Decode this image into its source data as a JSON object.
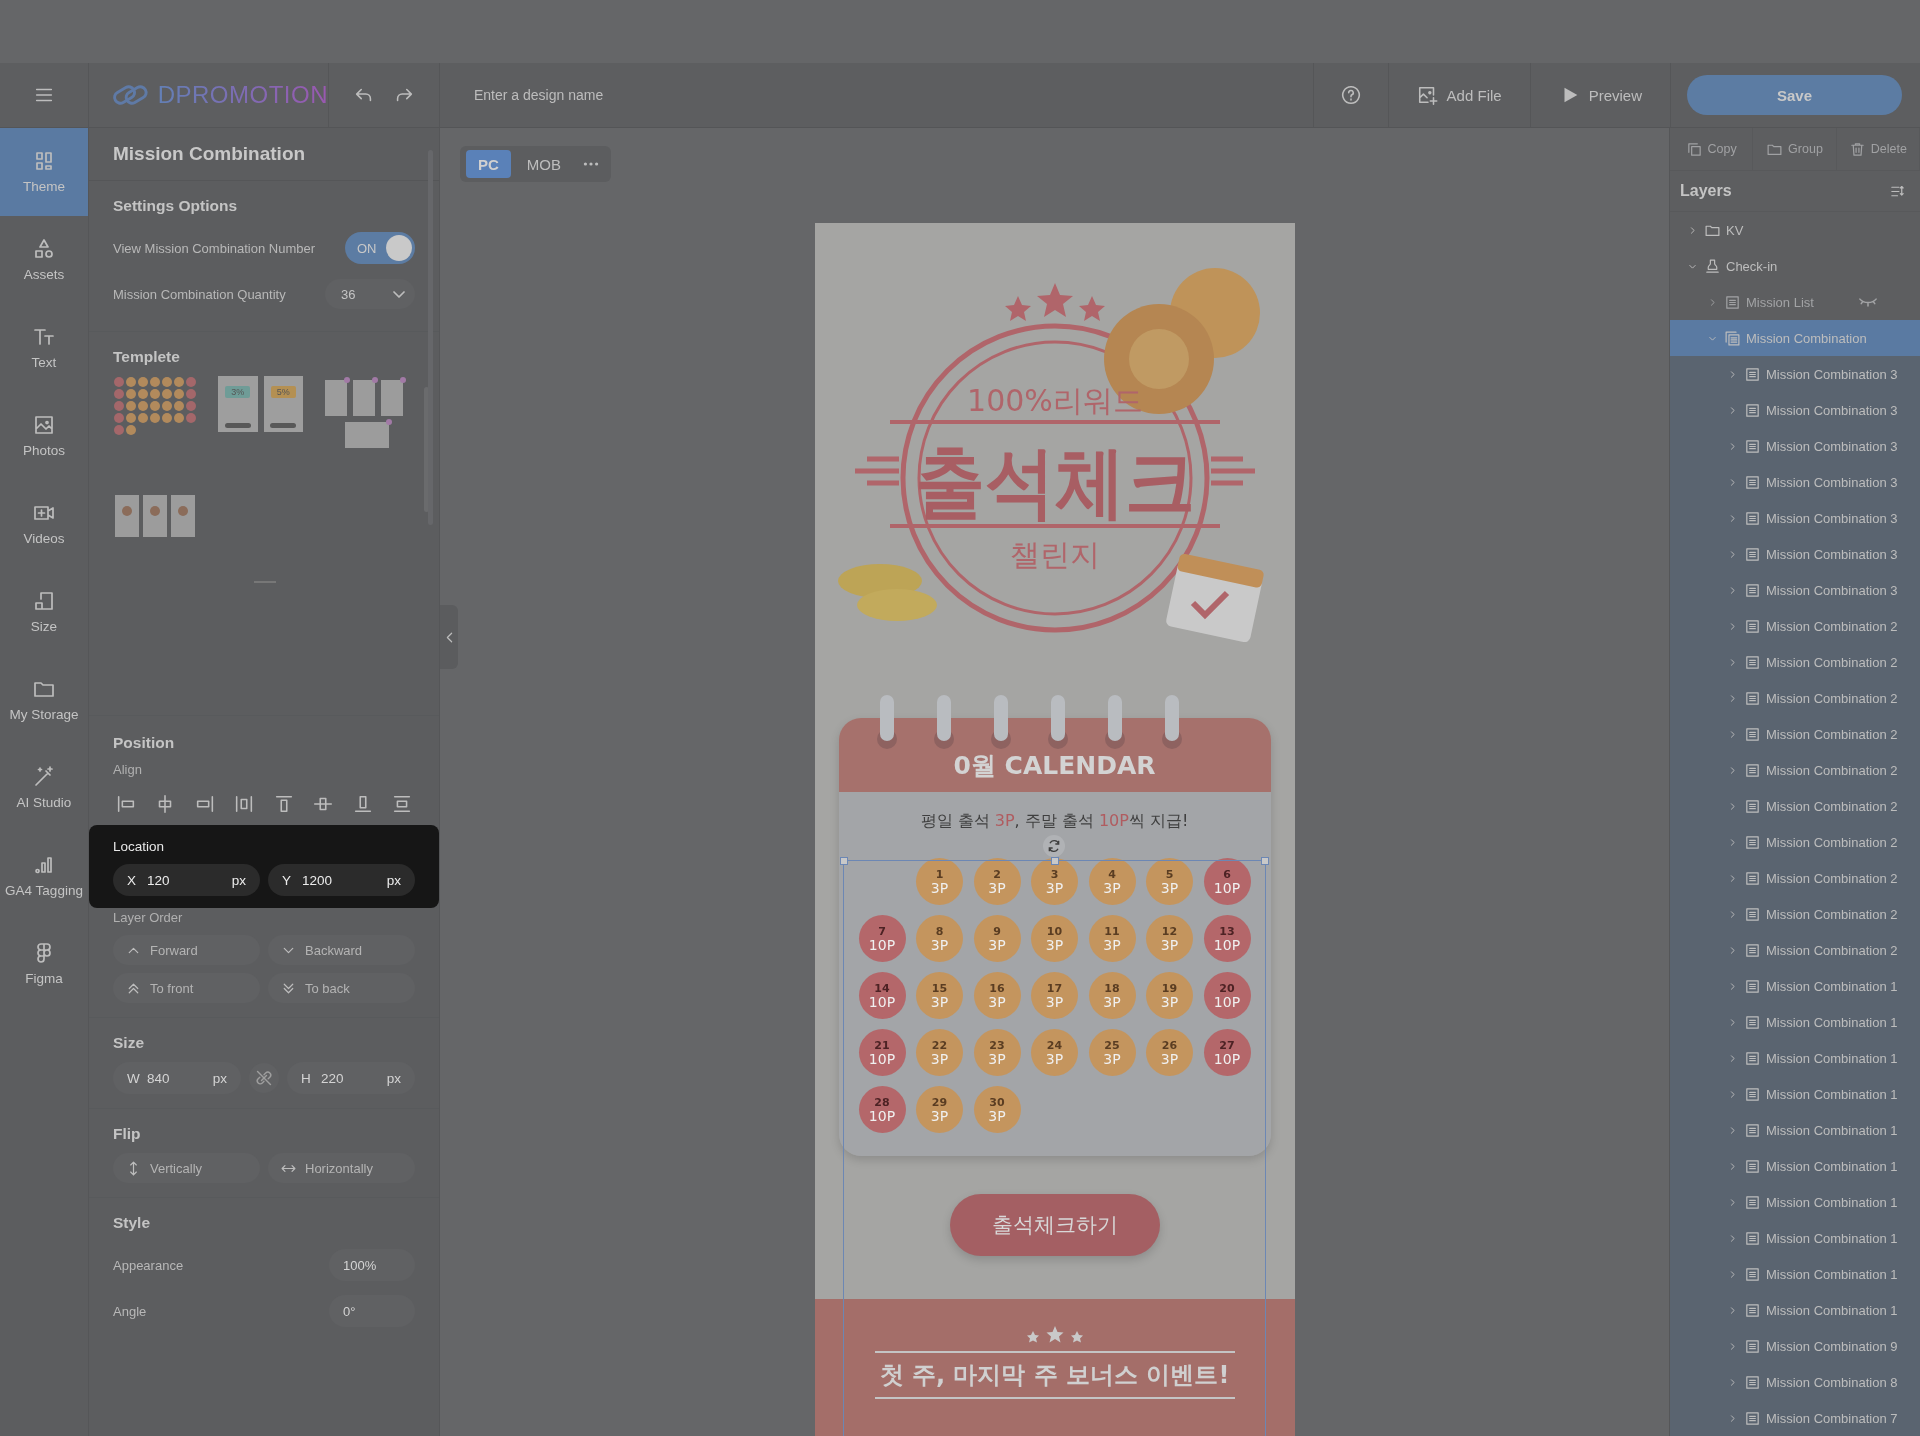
{
  "top_bar": {
    "logo": "DPROMOTION",
    "design_name": {
      "placeholder": "Enter a design name"
    },
    "actions": [
      {
        "label": "Add File",
        "kind": "addimage"
      },
      {
        "label": "Preview",
        "kind": "play"
      }
    ],
    "save": "Save"
  },
  "rail": [
    {
      "label": "Theme",
      "kind": "grid",
      "selected": true
    },
    {
      "label": "Assets",
      "kind": "shapes",
      "selected": false
    },
    {
      "label": "Text",
      "kind": "type",
      "selected": false
    },
    {
      "label": "Photos",
      "kind": "image",
      "selected": false
    },
    {
      "label": "Videos",
      "kind": "video",
      "selected": false
    },
    {
      "label": "Size",
      "kind": "resize",
      "selected": false
    },
    {
      "label": "My Storage",
      "kind": "folder",
      "selected": false
    },
    {
      "label": "AI Studio",
      "kind": "wand",
      "selected": false
    },
    {
      "label": "GA4 Tagging",
      "kind": "bars",
      "selected": false
    },
    {
      "label": "Figma",
      "kind": "figma",
      "selected": false
    }
  ],
  "panel": {
    "title": "Mission Combination",
    "settings": {
      "heading": "Settings Options",
      "number_toggle": {
        "label": "View Mission Combination Number",
        "on": true,
        "text": "ON"
      },
      "quantity": {
        "label": "Mission Combination Quantity",
        "value": "36"
      }
    },
    "template": {
      "heading": "Templete",
      "items": [
        {
          "kind": "dots"
        },
        {
          "kind": "coupons",
          "labels": [
            "3%",
            "5%"
          ]
        },
        {
          "kind": "cards"
        },
        {
          "kind": "products"
        }
      ]
    },
    "position": {
      "heading": "Position",
      "align_label": "Align",
      "location": {
        "label": "Location",
        "fields": [
          {
            "axis": "X",
            "value": "120",
            "unit": "px"
          },
          {
            "axis": "Y",
            "value": "1200",
            "unit": "px"
          }
        ]
      },
      "order_label": "Layer Order",
      "order_buttons": [
        {
          "label": "Forward",
          "kind": "up"
        },
        {
          "label": "Backward",
          "kind": "down"
        },
        {
          "label": "To front",
          "kind": "top"
        },
        {
          "label": "To back",
          "kind": "bottom"
        }
      ]
    },
    "size": {
      "heading": "Size",
      "fields": [
        {
          "axis": "W",
          "value": "840",
          "unit": "px"
        },
        {
          "axis": "H",
          "value": "220",
          "unit": "px"
        }
      ]
    },
    "flip": {
      "heading": "Flip",
      "buttons": [
        {
          "label": "Vertically",
          "kind": "vertical"
        },
        {
          "label": "Horizontally",
          "kind": "horizontal"
        }
      ]
    },
    "style": {
      "heading": "Style",
      "rows": [
        {
          "label": "Appearance",
          "value": "100%"
        },
        {
          "label": "Angle",
          "value": "0°"
        }
      ]
    }
  },
  "canvas": {
    "views": [
      {
        "label": "PC",
        "selected": true
      },
      {
        "label": "MOB",
        "selected": false
      }
    ],
    "design": {
      "hero": {
        "top_text": "100%리워드",
        "title": "출석체크",
        "subtitle": "챌린지"
      },
      "calendar": {
        "title": "0월 CALENDAR",
        "subtitle": [
          {
            "text": "평일 출석 ",
            "highlight": false
          },
          {
            "text": "3P",
            "highlight": true
          },
          {
            "text": ", 주말 출석 ",
            "highlight": false
          },
          {
            "text": "10P",
            "highlight": true
          },
          {
            "text": "씩 지급!",
            "highlight": false
          }
        ],
        "cells": [
          {
            "kind": "blank"
          },
          {
            "kind": "weekday",
            "day": "1",
            "points": "3P"
          },
          {
            "kind": "weekday",
            "day": "2",
            "points": "3P"
          },
          {
            "kind": "weekday",
            "day": "3",
            "points": "3P"
          },
          {
            "kind": "weekday",
            "day": "4",
            "points": "3P"
          },
          {
            "kind": "weekday",
            "day": "5",
            "points": "3P"
          },
          {
            "kind": "weekend",
            "day": "6",
            "points": "10P"
          },
          {
            "kind": "weekend",
            "day": "7",
            "points": "10P"
          },
          {
            "kind": "weekday",
            "day": "8",
            "points": "3P"
          },
          {
            "kind": "weekday",
            "day": "9",
            "points": "3P"
          },
          {
            "kind": "weekday",
            "day": "10",
            "points": "3P"
          },
          {
            "kind": "weekday",
            "day": "11",
            "points": "3P"
          },
          {
            "kind": "weekday",
            "day": "12",
            "points": "3P"
          },
          {
            "kind": "weekend",
            "day": "13",
            "points": "10P"
          },
          {
            "kind": "weekend",
            "day": "14",
            "points": "10P"
          },
          {
            "kind": "weekday",
            "day": "15",
            "points": "3P"
          },
          {
            "kind": "weekday",
            "day": "16",
            "points": "3P"
          },
          {
            "kind": "weekday",
            "day": "17",
            "points": "3P"
          },
          {
            "kind": "weekday",
            "day": "18",
            "points": "3P"
          },
          {
            "kind": "weekday",
            "day": "19",
            "points": "3P"
          },
          {
            "kind": "weekend",
            "day": "20",
            "points": "10P"
          },
          {
            "kind": "weekend",
            "day": "21",
            "points": "10P"
          },
          {
            "kind": "weekday",
            "day": "22",
            "points": "3P"
          },
          {
            "kind": "weekday",
            "day": "23",
            "points": "3P"
          },
          {
            "kind": "weekday",
            "day": "24",
            "points": "3P"
          },
          {
            "kind": "weekday",
            "day": "25",
            "points": "3P"
          },
          {
            "kind": "weekday",
            "day": "26",
            "points": "3P"
          },
          {
            "kind": "weekend",
            "day": "27",
            "points": "10P"
          },
          {
            "kind": "weekend",
            "day": "28",
            "points": "10P"
          },
          {
            "kind": "weekday",
            "day": "29",
            "points": "3P"
          },
          {
            "kind": "weekday",
            "day": "30",
            "points": "3P"
          }
        ]
      },
      "button": "출석체크하기",
      "bonus": "첫 주, 마지막 주 보너스 이벤트!"
    }
  },
  "layers": {
    "actions": [
      {
        "label": "Copy",
        "kind": "copy",
        "disabled": true
      },
      {
        "label": "Group",
        "kind": "folder",
        "disabled": true
      },
      {
        "label": "Delete",
        "kind": "trash",
        "disabled": true
      }
    ],
    "heading": "Layers",
    "tree": [
      {
        "label": "KV",
        "kind": "folder",
        "expanded": false,
        "selected": false,
        "hidden": false
      },
      {
        "label": "Check-in",
        "kind": "stamp",
        "expanded": true,
        "selected": false,
        "hidden": false,
        "children": [
          {
            "label": "Mission List",
            "kind": "list",
            "expanded": false,
            "selected": false,
            "hidden": true
          },
          {
            "label": "Mission Combination",
            "kind": "stack",
            "expanded": true,
            "selected": true,
            "hidden": false,
            "children": [
              {
                "label": "Mission Combination 3",
                "kind": "list",
                "expanded": false,
                "selected": false,
                "hidden": false
              },
              {
                "label": "Mission Combination 3",
                "kind": "list",
                "expanded": false,
                "selected": false,
                "hidden": false
              },
              {
                "label": "Mission Combination 3",
                "kind": "list",
                "expanded": false,
                "selected": false,
                "hidden": false
              },
              {
                "label": "Mission Combination 3",
                "kind": "list",
                "expanded": false,
                "selected": false,
                "hidden": false
              },
              {
                "label": "Mission Combination 3",
                "kind": "list",
                "expanded": false,
                "selected": false,
                "hidden": false
              },
              {
                "label": "Mission Combination 3",
                "kind": "list",
                "expanded": false,
                "selected": false,
                "hidden": false
              },
              {
                "label": "Mission Combination 3",
                "kind": "list",
                "expanded": false,
                "selected": false,
                "hidden": false
              },
              {
                "label": "Mission Combination 2",
                "kind": "list",
                "expanded": false,
                "selected": false,
                "hidden": false
              },
              {
                "label": "Mission Combination 2",
                "kind": "list",
                "expanded": false,
                "selected": false,
                "hidden": false
              },
              {
                "label": "Mission Combination 2",
                "kind": "list",
                "expanded": false,
                "selected": false,
                "hidden": false
              },
              {
                "label": "Mission Combination 2",
                "kind": "list",
                "expanded": false,
                "selected": false,
                "hidden": false
              },
              {
                "label": "Mission Combination 2",
                "kind": "list",
                "expanded": false,
                "selected": false,
                "hidden": false
              },
              {
                "label": "Mission Combination 2",
                "kind": "list",
                "expanded": false,
                "selected": false,
                "hidden": false
              },
              {
                "label": "Mission Combination 2",
                "kind": "list",
                "expanded": false,
                "selected": false,
                "hidden": false
              },
              {
                "label": "Mission Combination 2",
                "kind": "list",
                "expanded": false,
                "selected": false,
                "hidden": false
              },
              {
                "label": "Mission Combination 2",
                "kind": "list",
                "expanded": false,
                "selected": false,
                "hidden": false
              },
              {
                "label": "Mission Combination 2",
                "kind": "list",
                "expanded": false,
                "selected": false,
                "hidden": false
              },
              {
                "label": "Mission Combination 1",
                "kind": "list",
                "expanded": false,
                "selected": false,
                "hidden": false
              },
              {
                "label": "Mission Combination 1",
                "kind": "list",
                "expanded": false,
                "selected": false,
                "hidden": false
              },
              {
                "label": "Mission Combination 1",
                "kind": "list",
                "expanded": false,
                "selected": false,
                "hidden": false
              },
              {
                "label": "Mission Combination 1",
                "kind": "list",
                "expanded": false,
                "selected": false,
                "hidden": false
              },
              {
                "label": "Mission Combination 1",
                "kind": "list",
                "expanded": false,
                "selected": false,
                "hidden": false
              },
              {
                "label": "Mission Combination 1",
                "kind": "list",
                "expanded": false,
                "selected": false,
                "hidden": false
              },
              {
                "label": "Mission Combination 1",
                "kind": "list",
                "expanded": false,
                "selected": false,
                "hidden": false
              },
              {
                "label": "Mission Combination 1",
                "kind": "list",
                "expanded": false,
                "selected": false,
                "hidden": false
              },
              {
                "label": "Mission Combination 1",
                "kind": "list",
                "expanded": false,
                "selected": false,
                "hidden": false
              },
              {
                "label": "Mission Combination 1",
                "kind": "list",
                "expanded": false,
                "selected": false,
                "hidden": false
              },
              {
                "label": "Mission Combination 9",
                "kind": "list",
                "expanded": false,
                "selected": false,
                "hidden": false
              },
              {
                "label": "Mission Combination 8",
                "kind": "list",
                "expanded": false,
                "selected": false,
                "hidden": false
              },
              {
                "label": "Mission Combination 7",
                "kind": "list",
                "expanded": false,
                "selected": false,
                "hidden": false
              }
            ]
          }
        ]
      }
    ]
  }
}
